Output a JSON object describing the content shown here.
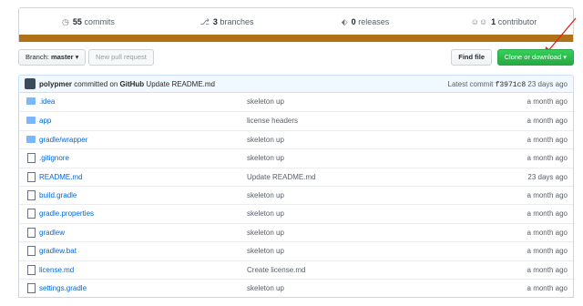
{
  "summary": {
    "commits_count": "55",
    "commits_label": "commits",
    "branches_count": "3",
    "branches_label": "branches",
    "releases_count": "0",
    "releases_label": "releases",
    "contributors_count": "1",
    "contributors_label": "contributor",
    "lang_color": "#b07219"
  },
  "toolbar": {
    "branch_prefix": "Branch:",
    "branch_name": "master",
    "new_pr_label": "New pull request",
    "find_file_label": "Find file",
    "clone_label": "Clone or download"
  },
  "commit": {
    "author": "polypmer",
    "committed_on": "committed on",
    "platform": "GitHub",
    "message": "Update README.md",
    "latest_label": "Latest commit",
    "sha": "f3971c8",
    "age": "23 days ago"
  },
  "files": [
    {
      "name": ".idea",
      "type": "folder",
      "message": "skeleton up",
      "age": "a month ago"
    },
    {
      "name": "app",
      "type": "folder",
      "message": "license headers",
      "age": "a month ago"
    },
    {
      "name": "gradle/wrapper",
      "type": "folder",
      "message": "skeleton up",
      "age": "a month ago"
    },
    {
      "name": ".gitignore",
      "type": "file",
      "message": "skeleton up",
      "age": "a month ago"
    },
    {
      "name": "README.md",
      "type": "file",
      "message": "Update README.md",
      "age": "23 days ago"
    },
    {
      "name": "build.gradle",
      "type": "file",
      "message": "skeleton up",
      "age": "a month ago"
    },
    {
      "name": "gradle.properties",
      "type": "file",
      "message": "skeleton up",
      "age": "a month ago"
    },
    {
      "name": "gradlew",
      "type": "file",
      "message": "skeleton up",
      "age": "a month ago"
    },
    {
      "name": "gradlew.bat",
      "type": "file",
      "message": "skeleton up",
      "age": "a month ago"
    },
    {
      "name": "license.md",
      "type": "file",
      "message": "Create license.md",
      "age": "a month ago"
    },
    {
      "name": "settings.gradle",
      "type": "file",
      "message": "skeleton up",
      "age": "a month ago"
    }
  ]
}
